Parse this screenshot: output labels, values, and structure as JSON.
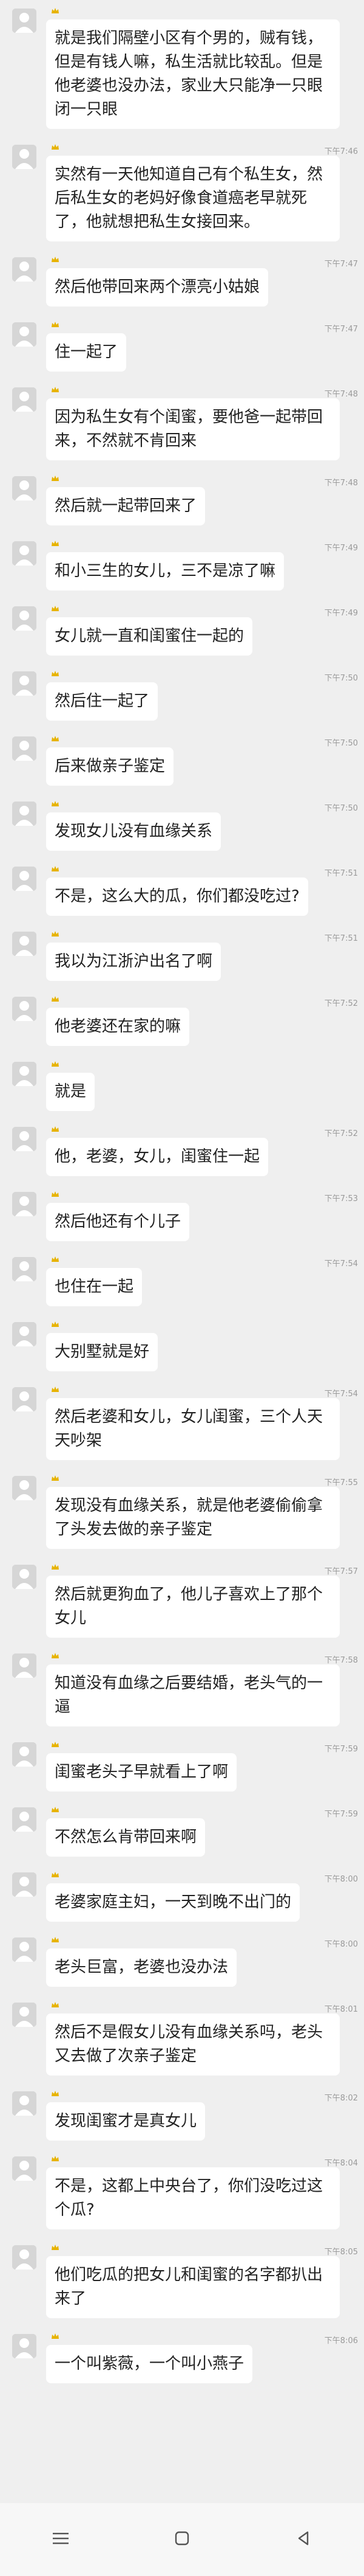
{
  "messages": [
    {
      "time": "",
      "text": "就是我们隔壁小区有个男的，贼有钱，但是有钱人嘛，私生活就比较乱。但是他老婆也没办法，家业大只能净一只眼闭一只眼"
    },
    {
      "time": "下午7:46",
      "text": "实然有一天他知道自己有个私生女，然后私生女的老妈好像食道癌老早就死了，他就想把私生女接回来。"
    },
    {
      "time": "下午7:47",
      "text": "然后他带回来两个漂亮小姑娘"
    },
    {
      "time": "下午7:47",
      "text": "住一起了"
    },
    {
      "time": "下午7:48",
      "text": "因为私生女有个闺蜜，要他爸一起带回来，不然就不肯回来"
    },
    {
      "time": "下午7:48",
      "text": "然后就一起带回来了"
    },
    {
      "time": "下午7:49",
      "text": "和小三生的女儿，三不是凉了嘛"
    },
    {
      "time": "下午7:49",
      "text": "女儿就一直和闺蜜住一起的"
    },
    {
      "time": "下午7:50",
      "text": "然后住一起了"
    },
    {
      "time": "下午7:50",
      "text": "后来做亲子鉴定"
    },
    {
      "time": "下午7:50",
      "text": "发现女儿没有血缘关系"
    },
    {
      "time": "下午7:51",
      "text": "不是，这么大的瓜，你们都没吃过?"
    },
    {
      "time": "下午7:51",
      "text": "我以为江浙沪出名了啊"
    },
    {
      "time": "下午7:52",
      "text": "他老婆还在家的嘛"
    },
    {
      "time": "",
      "text": "就是"
    },
    {
      "time": "下午7:52",
      "text": "他，老婆，女儿，闺蜜住一起"
    },
    {
      "time": "下午7:53",
      "text": "然后他还有个儿子"
    },
    {
      "time": "下午7:54",
      "text": "也住在一起"
    },
    {
      "time": "",
      "text": "大别墅就是好"
    },
    {
      "time": "下午7:54",
      "text": "然后老婆和女儿，女儿闺蜜，三个人天天吵架"
    },
    {
      "time": "下午7:55",
      "text": "发现没有血缘关系，就是他老婆偷偷拿了头发去做的亲子鉴定"
    },
    {
      "time": "下午7:57",
      "text": "然后就更狗血了，他儿子喜欢上了那个女儿"
    },
    {
      "time": "下午7:58",
      "text": "知道没有血缘之后要结婚，老头气的一逼"
    },
    {
      "time": "下午7:59",
      "text": "闺蜜老头子早就看上了啊"
    },
    {
      "time": "下午7:59",
      "text": "不然怎么肯带回来啊"
    },
    {
      "time": "下午8:00",
      "text": "老婆家庭主妇，一天到晚不出门的"
    },
    {
      "time": "下午8:00",
      "text": "老头巨富，老婆也没办法"
    },
    {
      "time": "下午8:01",
      "text": "然后不是假女儿没有血缘关系吗，老头又去做了次亲子鉴定"
    },
    {
      "time": "下午8:02",
      "text": "发现闺蜜才是真女儿"
    },
    {
      "time": "下午8:04",
      "text": "不是，这都上中央台了，你们没吃过这个瓜?"
    },
    {
      "time": "下午8:05",
      "text": "他们吃瓜的把女儿和闺蜜的名字都扒出来了"
    },
    {
      "time": "下午8:06",
      "text": "一个叫紫薇，一个叫小燕子"
    }
  ],
  "icons": {
    "avatar": "default-avatar-icon",
    "badge": "crown-badge-icon",
    "nav": [
      "menu-icon",
      "home-icon",
      "back-icon"
    ]
  },
  "colors": {
    "background": "#efefef",
    "bubble": "#ffffff",
    "badge": "#e7b300",
    "time": "#9a9a9a"
  }
}
